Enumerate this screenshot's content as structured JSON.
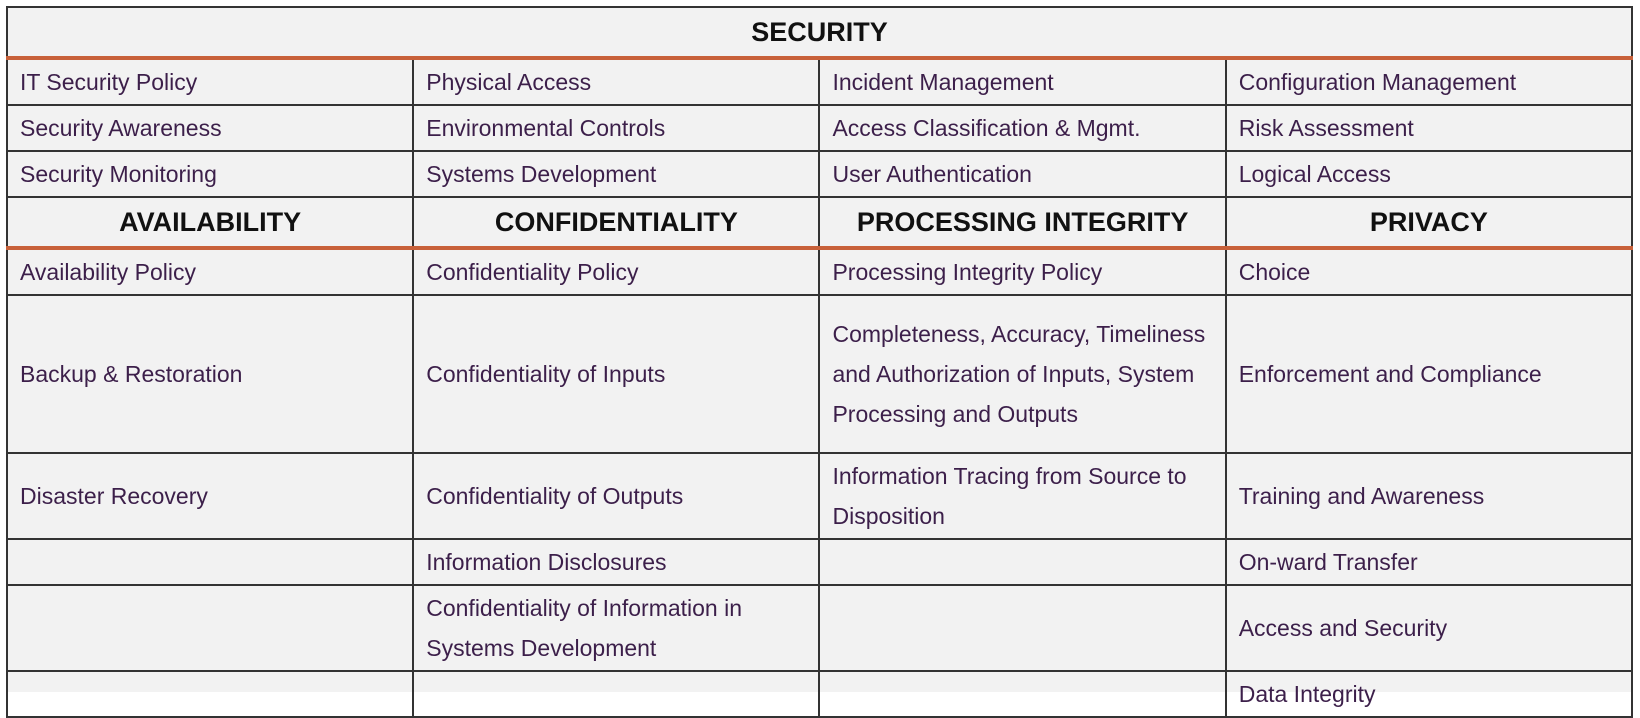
{
  "security": {
    "title": "SECURITY",
    "rows": [
      [
        "IT Security Policy",
        "Physical Access",
        "Incident Management",
        "Configuration Management"
      ],
      [
        "Security Awareness",
        "Environmental Controls",
        "Access Classification & Mgmt.",
        "Risk Assessment"
      ],
      [
        "Security Monitoring",
        "Systems Development",
        "User Authentication",
        "Logical Access"
      ]
    ]
  },
  "headers": [
    "AVAILABILITY",
    "CONFIDENTIALITY",
    "PROCESSING INTEGRITY",
    "PRIVACY"
  ],
  "rows": [
    [
      "Availability Policy",
      "Confidentiality Policy",
      "Processing Integrity Policy",
      "Choice"
    ],
    [
      "Backup & Restoration",
      "Confidentiality of Inputs",
      "Completeness, Accuracy, Timeliness and Authorization of Inputs, System Processing and Outputs",
      "Enforcement and Compliance"
    ],
    [
      "Disaster Recovery",
      "Confidentiality of Outputs",
      "Information Tracing from Source to Disposition",
      "Training and Awareness"
    ],
    [
      "",
      "Information Disclosures",
      "",
      "On-ward Transfer"
    ],
    [
      "",
      "Confidentiality of Information in Systems Development",
      "",
      "Access and Security"
    ],
    [
      "",
      "",
      "",
      "Data Integrity"
    ]
  ],
  "colors": {
    "text": "#3c1f4a",
    "header_text": "#111111",
    "divider": "#c8613a",
    "border": "#333333",
    "background": "#f2f2f2"
  }
}
